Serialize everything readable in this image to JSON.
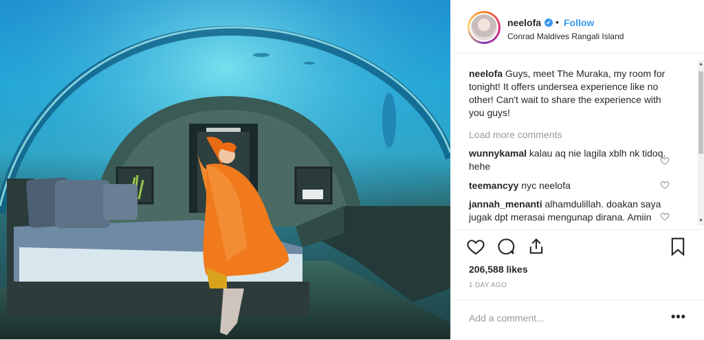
{
  "header": {
    "username": "neelofa",
    "verified_glyph": "✔",
    "separator": "•",
    "follow_label": "Follow",
    "location": "Conrad Maldives Rangali Island"
  },
  "caption": {
    "username": "neelofa",
    "text": "Guys, meet The Muraka, my room for tonight! It offers undersea experience like no other! Can't wait to share the experience with you guys!"
  },
  "load_more_label": "Load more comments",
  "comments": [
    {
      "username": "wunnykamal",
      "text": "kalau aq nie lagila xblh nk tidoq. hehe"
    },
    {
      "username": "teemancyy",
      "text": "nyc neelofa"
    },
    {
      "username": "jannah_menanti",
      "text": "alhamdulillah. doakan saya jugak dpt merasai mengunap dirana. Amiin"
    }
  ],
  "actions": {
    "icons": [
      "heart-icon",
      "comment-icon",
      "share-icon",
      "bookmark-icon"
    ]
  },
  "likes_label": "206,588 likes",
  "time_label": "1 DAY AGO",
  "add_comment_placeholder": "Add a comment...",
  "more_label": "•••",
  "colors": {
    "link_blue": "#3897f0",
    "muted": "#999999",
    "text": "#262626",
    "orange_dress": "#f07a1c"
  }
}
